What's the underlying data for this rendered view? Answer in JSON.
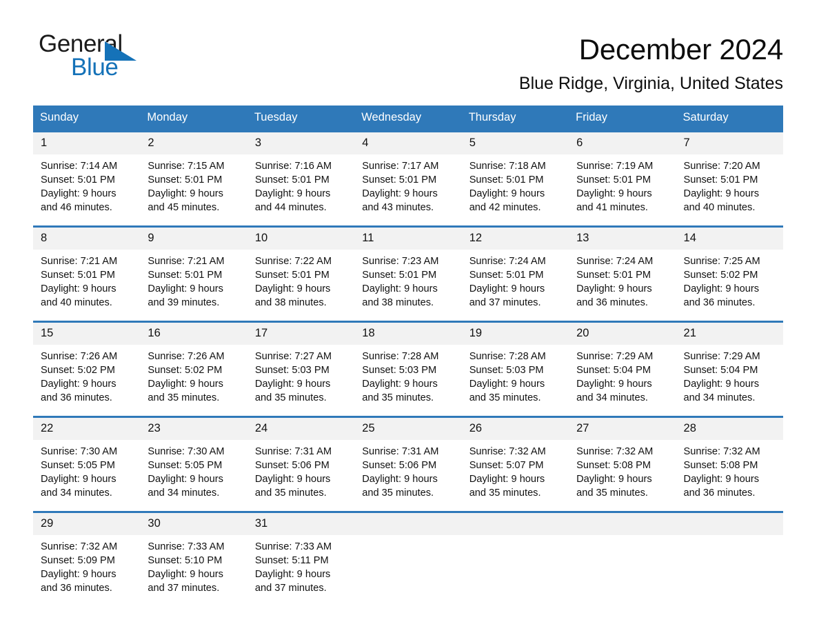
{
  "brand": {
    "name_top": "General",
    "name_bottom": "Blue",
    "color_blue": "#1572b8"
  },
  "header": {
    "month_title": "December 2024",
    "location": "Blue Ridge, Virginia, United States"
  },
  "colors": {
    "header_band": "#2f79b9",
    "daynum_band": "#f2f2f2",
    "text": "#111111"
  },
  "weekdays": [
    "Sunday",
    "Monday",
    "Tuesday",
    "Wednesday",
    "Thursday",
    "Friday",
    "Saturday"
  ],
  "weeks": [
    {
      "days": [
        {
          "num": "1",
          "sunrise": "Sunrise: 7:14 AM",
          "sunset": "Sunset: 5:01 PM",
          "daylight1": "Daylight: 9 hours",
          "daylight2": "and 46 minutes."
        },
        {
          "num": "2",
          "sunrise": "Sunrise: 7:15 AM",
          "sunset": "Sunset: 5:01 PM",
          "daylight1": "Daylight: 9 hours",
          "daylight2": "and 45 minutes."
        },
        {
          "num": "3",
          "sunrise": "Sunrise: 7:16 AM",
          "sunset": "Sunset: 5:01 PM",
          "daylight1": "Daylight: 9 hours",
          "daylight2": "and 44 minutes."
        },
        {
          "num": "4",
          "sunrise": "Sunrise: 7:17 AM",
          "sunset": "Sunset: 5:01 PM",
          "daylight1": "Daylight: 9 hours",
          "daylight2": "and 43 minutes."
        },
        {
          "num": "5",
          "sunrise": "Sunrise: 7:18 AM",
          "sunset": "Sunset: 5:01 PM",
          "daylight1": "Daylight: 9 hours",
          "daylight2": "and 42 minutes."
        },
        {
          "num": "6",
          "sunrise": "Sunrise: 7:19 AM",
          "sunset": "Sunset: 5:01 PM",
          "daylight1": "Daylight: 9 hours",
          "daylight2": "and 41 minutes."
        },
        {
          "num": "7",
          "sunrise": "Sunrise: 7:20 AM",
          "sunset": "Sunset: 5:01 PM",
          "daylight1": "Daylight: 9 hours",
          "daylight2": "and 40 minutes."
        }
      ]
    },
    {
      "days": [
        {
          "num": "8",
          "sunrise": "Sunrise: 7:21 AM",
          "sunset": "Sunset: 5:01 PM",
          "daylight1": "Daylight: 9 hours",
          "daylight2": "and 40 minutes."
        },
        {
          "num": "9",
          "sunrise": "Sunrise: 7:21 AM",
          "sunset": "Sunset: 5:01 PM",
          "daylight1": "Daylight: 9 hours",
          "daylight2": "and 39 minutes."
        },
        {
          "num": "10",
          "sunrise": "Sunrise: 7:22 AM",
          "sunset": "Sunset: 5:01 PM",
          "daylight1": "Daylight: 9 hours",
          "daylight2": "and 38 minutes."
        },
        {
          "num": "11",
          "sunrise": "Sunrise: 7:23 AM",
          "sunset": "Sunset: 5:01 PM",
          "daylight1": "Daylight: 9 hours",
          "daylight2": "and 38 minutes."
        },
        {
          "num": "12",
          "sunrise": "Sunrise: 7:24 AM",
          "sunset": "Sunset: 5:01 PM",
          "daylight1": "Daylight: 9 hours",
          "daylight2": "and 37 minutes."
        },
        {
          "num": "13",
          "sunrise": "Sunrise: 7:24 AM",
          "sunset": "Sunset: 5:01 PM",
          "daylight1": "Daylight: 9 hours",
          "daylight2": "and 36 minutes."
        },
        {
          "num": "14",
          "sunrise": "Sunrise: 7:25 AM",
          "sunset": "Sunset: 5:02 PM",
          "daylight1": "Daylight: 9 hours",
          "daylight2": "and 36 minutes."
        }
      ]
    },
    {
      "days": [
        {
          "num": "15",
          "sunrise": "Sunrise: 7:26 AM",
          "sunset": "Sunset: 5:02 PM",
          "daylight1": "Daylight: 9 hours",
          "daylight2": "and 36 minutes."
        },
        {
          "num": "16",
          "sunrise": "Sunrise: 7:26 AM",
          "sunset": "Sunset: 5:02 PM",
          "daylight1": "Daylight: 9 hours",
          "daylight2": "and 35 minutes."
        },
        {
          "num": "17",
          "sunrise": "Sunrise: 7:27 AM",
          "sunset": "Sunset: 5:03 PM",
          "daylight1": "Daylight: 9 hours",
          "daylight2": "and 35 minutes."
        },
        {
          "num": "18",
          "sunrise": "Sunrise: 7:28 AM",
          "sunset": "Sunset: 5:03 PM",
          "daylight1": "Daylight: 9 hours",
          "daylight2": "and 35 minutes."
        },
        {
          "num": "19",
          "sunrise": "Sunrise: 7:28 AM",
          "sunset": "Sunset: 5:03 PM",
          "daylight1": "Daylight: 9 hours",
          "daylight2": "and 35 minutes."
        },
        {
          "num": "20",
          "sunrise": "Sunrise: 7:29 AM",
          "sunset": "Sunset: 5:04 PM",
          "daylight1": "Daylight: 9 hours",
          "daylight2": "and 34 minutes."
        },
        {
          "num": "21",
          "sunrise": "Sunrise: 7:29 AM",
          "sunset": "Sunset: 5:04 PM",
          "daylight1": "Daylight: 9 hours",
          "daylight2": "and 34 minutes."
        }
      ]
    },
    {
      "days": [
        {
          "num": "22",
          "sunrise": "Sunrise: 7:30 AM",
          "sunset": "Sunset: 5:05 PM",
          "daylight1": "Daylight: 9 hours",
          "daylight2": "and 34 minutes."
        },
        {
          "num": "23",
          "sunrise": "Sunrise: 7:30 AM",
          "sunset": "Sunset: 5:05 PM",
          "daylight1": "Daylight: 9 hours",
          "daylight2": "and 34 minutes."
        },
        {
          "num": "24",
          "sunrise": "Sunrise: 7:31 AM",
          "sunset": "Sunset: 5:06 PM",
          "daylight1": "Daylight: 9 hours",
          "daylight2": "and 35 minutes."
        },
        {
          "num": "25",
          "sunrise": "Sunrise: 7:31 AM",
          "sunset": "Sunset: 5:06 PM",
          "daylight1": "Daylight: 9 hours",
          "daylight2": "and 35 minutes."
        },
        {
          "num": "26",
          "sunrise": "Sunrise: 7:32 AM",
          "sunset": "Sunset: 5:07 PM",
          "daylight1": "Daylight: 9 hours",
          "daylight2": "and 35 minutes."
        },
        {
          "num": "27",
          "sunrise": "Sunrise: 7:32 AM",
          "sunset": "Sunset: 5:08 PM",
          "daylight1": "Daylight: 9 hours",
          "daylight2": "and 35 minutes."
        },
        {
          "num": "28",
          "sunrise": "Sunrise: 7:32 AM",
          "sunset": "Sunset: 5:08 PM",
          "daylight1": "Daylight: 9 hours",
          "daylight2": "and 36 minutes."
        }
      ]
    },
    {
      "days": [
        {
          "num": "29",
          "sunrise": "Sunrise: 7:32 AM",
          "sunset": "Sunset: 5:09 PM",
          "daylight1": "Daylight: 9 hours",
          "daylight2": "and 36 minutes."
        },
        {
          "num": "30",
          "sunrise": "Sunrise: 7:33 AM",
          "sunset": "Sunset: 5:10 PM",
          "daylight1": "Daylight: 9 hours",
          "daylight2": "and 37 minutes."
        },
        {
          "num": "31",
          "sunrise": "Sunrise: 7:33 AM",
          "sunset": "Sunset: 5:11 PM",
          "daylight1": "Daylight: 9 hours",
          "daylight2": "and 37 minutes."
        },
        {
          "num": "",
          "sunrise": "",
          "sunset": "",
          "daylight1": "",
          "daylight2": ""
        },
        {
          "num": "",
          "sunrise": "",
          "sunset": "",
          "daylight1": "",
          "daylight2": ""
        },
        {
          "num": "",
          "sunrise": "",
          "sunset": "",
          "daylight1": "",
          "daylight2": ""
        },
        {
          "num": "",
          "sunrise": "",
          "sunset": "",
          "daylight1": "",
          "daylight2": ""
        }
      ]
    }
  ]
}
